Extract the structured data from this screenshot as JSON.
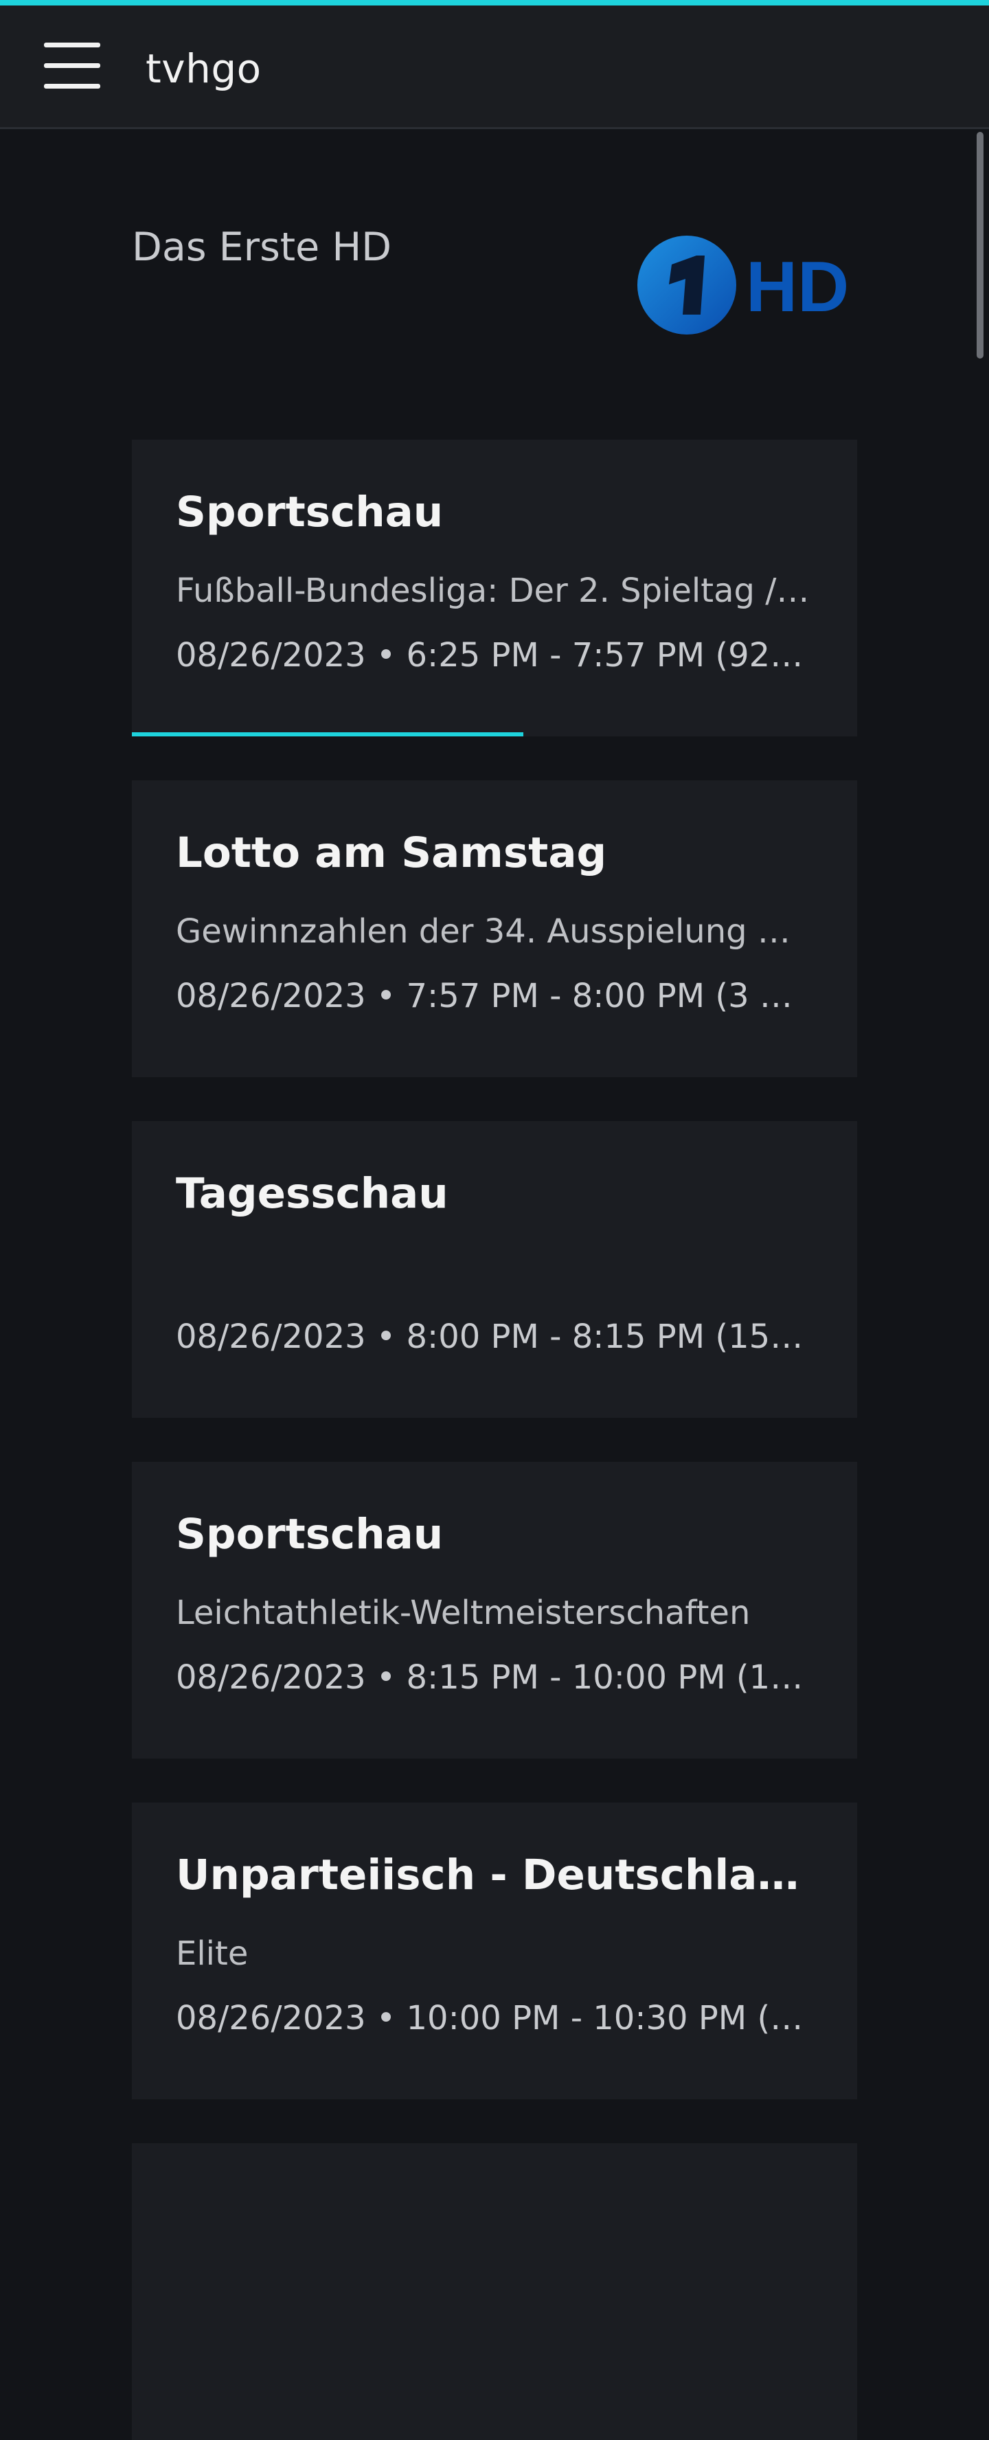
{
  "app_bar": {
    "title": "tvhgo",
    "menu_icon": "hamburger-menu-icon"
  },
  "colors": {
    "accent": "#1ed3dd",
    "background": "#121418",
    "card": "#1b1d22",
    "app_bar": "#1b1d21",
    "logo_blue": "#0a56b8"
  },
  "channel": {
    "name": "Das Erste HD",
    "logo_icon": "das-erste-hd-logo"
  },
  "programs": [
    {
      "title": "Sportschau",
      "description": "Fußball-Bundesliga: Der 2. Spieltag / 2…",
      "time": "08/26/2023 • 6:25 PM - 7:57 PM (92 min.)",
      "progress_fraction": 0.54
    },
    {
      "title": "Lotto am Samstag",
      "description": "Gewinnzahlen der 34. Ausspielung Mo…",
      "time": "08/26/2023 • 7:57 PM - 8:00 PM (3 min.)"
    },
    {
      "title": "Tagesschau",
      "description": "",
      "time": "08/26/2023 • 8:00 PM - 8:15 PM (15 min.)"
    },
    {
      "title": "Sportschau",
      "description": "Leichtathletik-Weltmeisterschaften",
      "time": "08/26/2023 • 8:15 PM - 10:00 PM (105 …"
    },
    {
      "title": "Unparteiisch - Deutschlands …",
      "description": "Elite",
      "time": "08/26/2023 • 10:00 PM - 10:30 PM (30…"
    },
    {
      "title": "",
      "description": "",
      "time": ""
    }
  ]
}
